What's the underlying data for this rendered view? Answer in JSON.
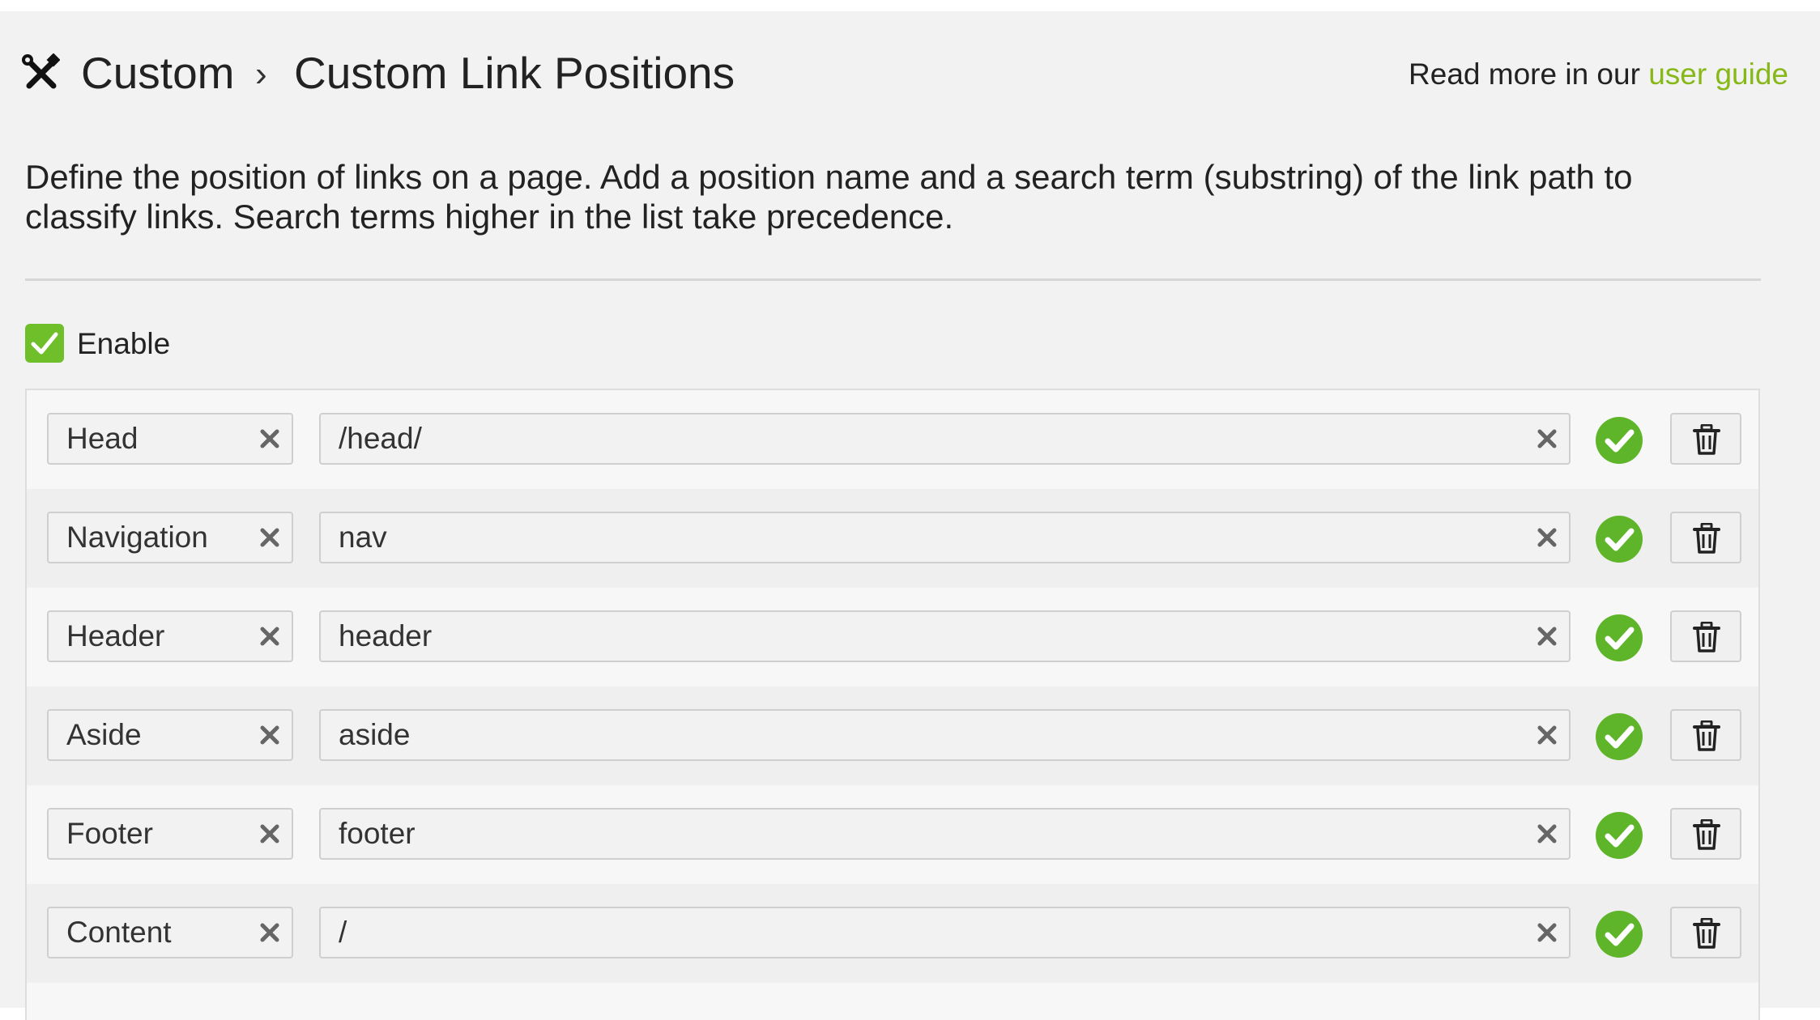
{
  "header": {
    "icon": "tools-icon",
    "breadcrumb_root": "Custom",
    "breadcrumb_separator": "›",
    "title": "Custom Link Positions",
    "guide_prefix": "Read more in our",
    "guide_link": "user guide"
  },
  "description": "Define the position of links on a page. Add a position name and a search term (substring) of the link path to classify links. Search terms higher in the list take precedence.",
  "enable": {
    "label": "Enable",
    "checked": true
  },
  "positions": [
    {
      "name": "Head",
      "term": "/head/"
    },
    {
      "name": "Navigation",
      "term": "nav"
    },
    {
      "name": "Header",
      "term": "header"
    },
    {
      "name": "Aside",
      "term": "aside"
    },
    {
      "name": "Footer",
      "term": "footer"
    },
    {
      "name": "Content",
      "term": "/"
    }
  ],
  "colors": {
    "accent_green": "#6fbf2a",
    "link_green": "#86b817",
    "valid_green": "#5fb52a"
  },
  "icons": {
    "clear": "close-icon",
    "valid": "check-circle-icon",
    "delete": "trash-icon"
  }
}
